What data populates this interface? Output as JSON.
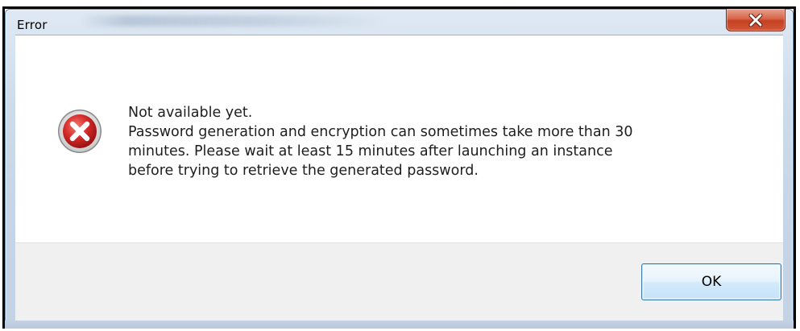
{
  "window": {
    "title": "Error"
  },
  "dialog": {
    "icon": "error-icon",
    "message_lines": [
      "Not available yet.",
      "Password generation and encryption can sometimes take more than 30",
      "minutes. Please wait at least 15 minutes after launching an instance",
      "before trying to retrieve the generated password."
    ],
    "ok_label": "OK"
  },
  "colors": {
    "error_red": "#d42a2a",
    "close_button": "#c5401f",
    "button_border": "#3c7fb1"
  }
}
